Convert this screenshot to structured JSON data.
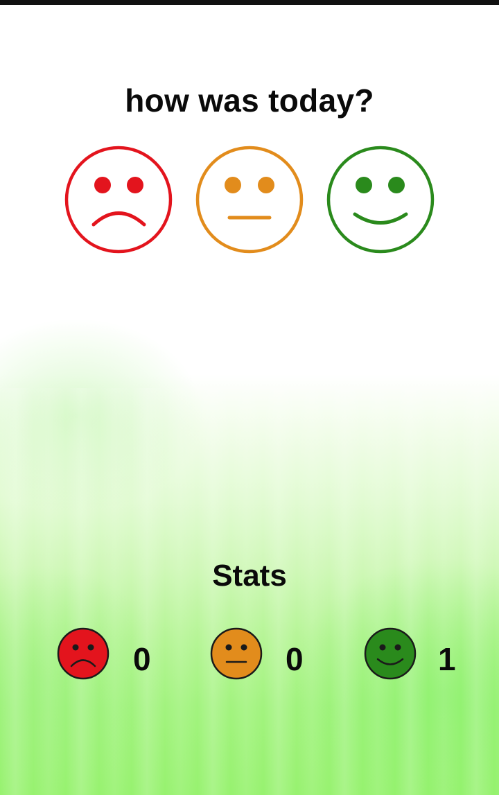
{
  "prompt": {
    "title": "how was today?"
  },
  "moods": [
    {
      "id": "sad",
      "icon": "sad-face-icon",
      "color": "#e3141d"
    },
    {
      "id": "neutral",
      "icon": "neutral-face-icon",
      "color": "#e28c1c"
    },
    {
      "id": "happy",
      "icon": "happy-face-icon",
      "color": "#2a8a1c"
    }
  ],
  "stats": {
    "title": "Stats",
    "items": [
      {
        "id": "sad",
        "icon": "sad-face-filled-icon",
        "color": "#e3141d",
        "count": "0"
      },
      {
        "id": "neutral",
        "icon": "neutral-face-filled-icon",
        "color": "#e28c1c",
        "count": "0"
      },
      {
        "id": "happy",
        "icon": "happy-face-filled-icon",
        "color": "#2a8a1c",
        "count": "1"
      }
    ]
  },
  "theme": {
    "background_bottom": "#97f26f",
    "text": "#0a0a0a"
  }
}
